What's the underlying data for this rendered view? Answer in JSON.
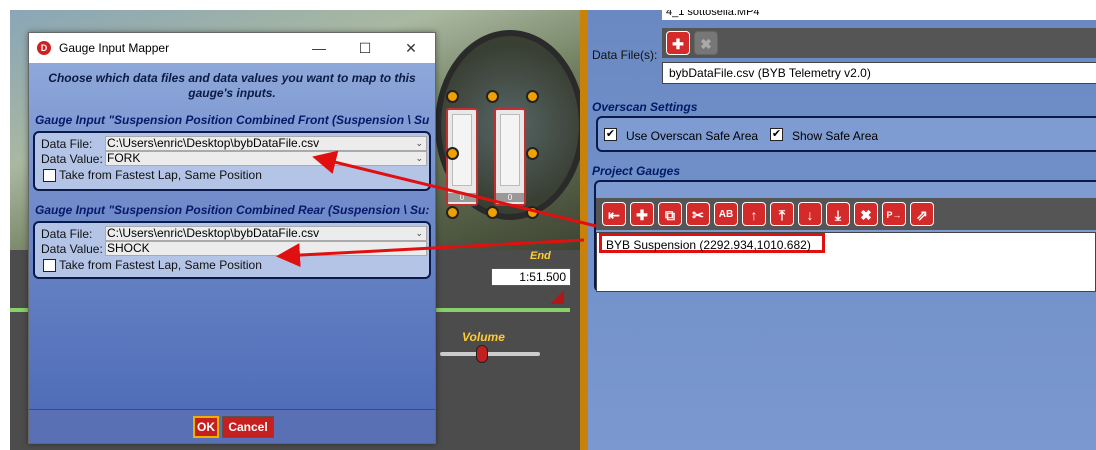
{
  "dialog": {
    "title": "Gauge Input Mapper",
    "instructions": "Choose which data files and data values you want to map to this gauge's inputs.",
    "inputs": [
      {
        "title": "Gauge Input \"Suspension Position Combined Front (Suspension \\ Su",
        "file_label": "Data File:",
        "file_value": "C:\\Users\\enric\\Desktop\\bybDataFile.csv",
        "value_label": "Data Value:",
        "value_value": "FORK",
        "checkbox_label": "Take from Fastest Lap, Same Position"
      },
      {
        "title": "Gauge Input \"Suspension Position Combined Rear (Suspension \\ Su:",
        "file_label": "Data File:",
        "file_value": "C:\\Users\\enric\\Desktop\\bybDataFile.csv",
        "value_label": "Data Value:",
        "value_value": "SHOCK",
        "checkbox_label": "Take from Fastest Lap, Same Position"
      }
    ],
    "ok_label": "OK",
    "cancel_label": "Cancel",
    "window_buttons": {
      "minimize": "—",
      "maximize": "☐",
      "close": "✕"
    }
  },
  "video": {
    "gauge_values": [
      "0",
      "0"
    ],
    "end_label": "End",
    "end_time": "1:51.500",
    "volume_label": "Volume"
  },
  "right_panel": {
    "top_file": "4_1 sottosella.MP4",
    "data_files_label": "Data File(s):",
    "data_file_entry": "bybDataFile.csv (BYB Telemetry v2.0)",
    "overscan_title": "Overscan Settings",
    "use_overscan_label": "Use Overscan Safe Area",
    "show_safe_label": "Show Safe Area",
    "project_gauges_title": "Project Gauges",
    "gauge_item": "BYB Suspension (2292.934,1010.682)"
  },
  "colors": {
    "accent_red": "#d42a2a",
    "annotation_red": "#e01010",
    "header_orange": "#c8820a"
  }
}
